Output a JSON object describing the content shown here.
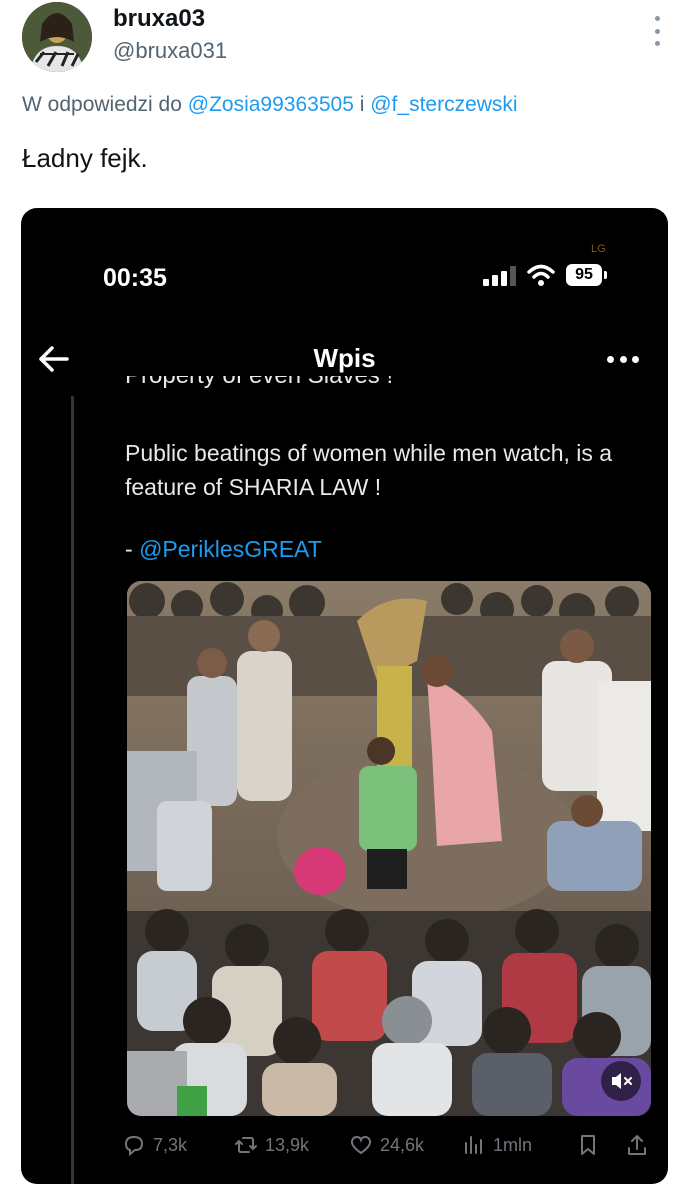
{
  "author": {
    "display_name": "bruxa03",
    "handle": "@bruxa031"
  },
  "reply_context": {
    "prefix": "W odpowiedzi do",
    "mention_1": "@Zosia99363505",
    "joiner": "i",
    "mention_2": "@f_sterczewski"
  },
  "tweet_text": "Ładny fejk.",
  "embedded_screenshot": {
    "status_bar": {
      "time": "00:35",
      "battery": "95",
      "tag": "LG"
    },
    "nav": {
      "title": "Wpis"
    },
    "cut_text": "Property of even Slaves !",
    "quote_text": "Public beatings of women while men watch, is a feature of SHARIA LAW !",
    "attribution_prefix": "-",
    "attribution_mention": "@PeriklesGREAT",
    "actions": {
      "replies": "7,3k",
      "reposts": "13,9k",
      "likes": "24,6k",
      "views": "1mln"
    }
  },
  "icons": {
    "more": "more-vertical-icon",
    "back": "arrow-left-icon",
    "nav_more": "more-horizontal-icon",
    "mute": "speaker-muted-icon",
    "reply": "reply-icon",
    "repost": "repost-icon",
    "like": "heart-icon",
    "views": "bar-chart-icon",
    "bookmark": "bookmark-icon",
    "share": "share-icon"
  },
  "colors": {
    "accent": "#1d9bf0",
    "muted": "#536471",
    "dark_bg": "#000000"
  }
}
